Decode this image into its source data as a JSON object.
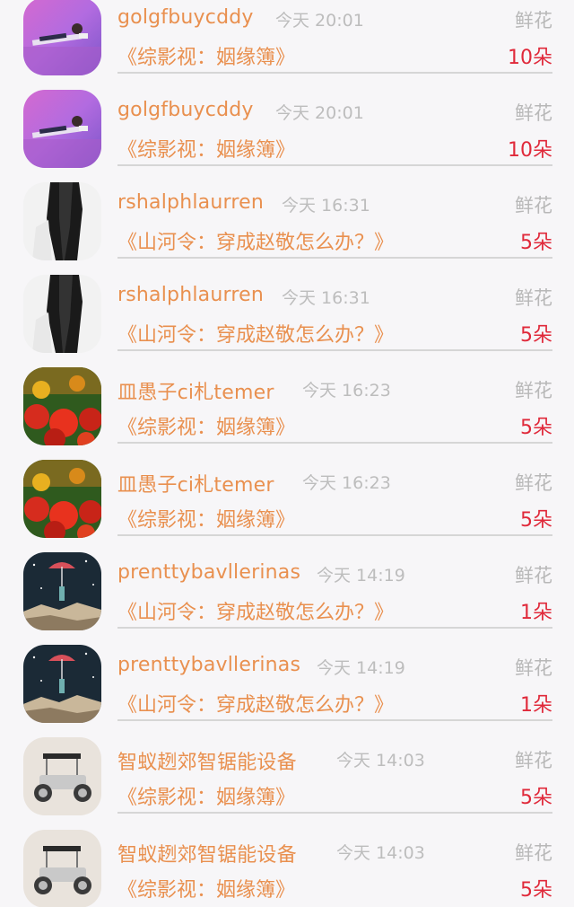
{
  "gifts": [
    {
      "user": "golgfbuycddy",
      "time": "今天 20:01",
      "type": "鲜花",
      "book": "《综影视：姻缘簿》",
      "count": "10朵",
      "avatar": "person-lying-avatar"
    },
    {
      "user": "golgfbuycddy",
      "time": "今天 20:01",
      "type": "鲜花",
      "book": "《综影视：姻缘簿》",
      "count": "10朵",
      "avatar": "person-lying-avatar"
    },
    {
      "user": "rshalphlaurren",
      "time": "今天 16:31",
      "type": "鲜花",
      "book": "《山河令：穿成赵敬怎么办？》",
      "count": "5朵",
      "avatar": "long-hair-avatar"
    },
    {
      "user": "rshalphlaurren",
      "time": "今天 16:31",
      "type": "鲜花",
      "book": "《山河令：穿成赵敬怎么办？》",
      "count": "5朵",
      "avatar": "long-hair-avatar"
    },
    {
      "user": "皿愚子ci札temer",
      "time": "今天 16:23",
      "type": "鲜花",
      "book": "《综影视：姻缘簿》",
      "count": "5朵",
      "avatar": "red-flowers-avatar"
    },
    {
      "user": "皿愚子ci札temer",
      "time": "今天 16:23",
      "type": "鲜花",
      "book": "《综影视：姻缘簿》",
      "count": "5朵",
      "avatar": "red-flowers-avatar"
    },
    {
      "user": "prenttybavllerinas",
      "time": "今天 14:19",
      "type": "鲜花",
      "book": "《山河令：穿成赵敬怎么办？》",
      "count": "1朵",
      "avatar": "umbrella-girl-avatar"
    },
    {
      "user": "prenttybavllerinas",
      "time": "今天 14:19",
      "type": "鲜花",
      "book": "《山河令：穿成赵敬怎么办？》",
      "count": "1朵",
      "avatar": "umbrella-girl-avatar"
    },
    {
      "user": "智蚁趔郊智锯能设备",
      "time": "今天 14:03",
      "type": "鲜花",
      "book": "《综影视：姻缘簿》",
      "count": "5朵",
      "avatar": "toy-car-avatar"
    },
    {
      "user": "智蚁趔郊智锯能设备",
      "time": "今天 14:03",
      "type": "鲜花",
      "book": "《综影视：姻缘簿》",
      "count": "5朵",
      "avatar": "toy-car-avatar"
    }
  ]
}
